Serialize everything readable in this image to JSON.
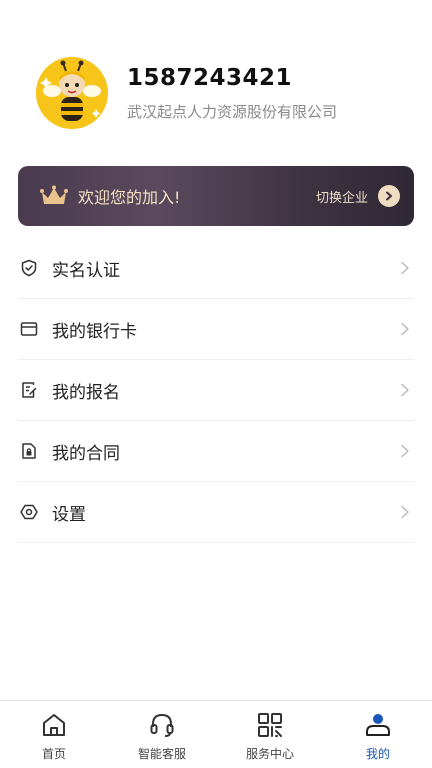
{
  "profile": {
    "phone": "1587243421",
    "company": "武汉起点人力资源股份有限公司",
    "avatar_icon": "bee-mascot-avatar"
  },
  "banner": {
    "welcome_text": "欢迎您的加入!",
    "switch_label": "切换企业",
    "crown_icon": "crown-icon",
    "accent_color": "#f0dcc0"
  },
  "menu": {
    "items": [
      {
        "label": "实名认证",
        "icon": "shield-check-icon"
      },
      {
        "label": "我的银行卡",
        "icon": "bank-card-icon"
      },
      {
        "label": "我的报名",
        "icon": "signup-form-icon"
      },
      {
        "label": "我的合同",
        "icon": "contract-icon"
      },
      {
        "label": "设置",
        "icon": "settings-icon"
      }
    ]
  },
  "tabbar": {
    "active_color": "#1a56b8",
    "tabs": [
      {
        "label": "首页",
        "icon": "home-icon",
        "active": false
      },
      {
        "label": "智能客服",
        "icon": "headset-icon",
        "active": false
      },
      {
        "label": "服务中心",
        "icon": "qr-code-icon",
        "active": false
      },
      {
        "label": "我的",
        "icon": "user-icon",
        "active": true
      }
    ]
  }
}
